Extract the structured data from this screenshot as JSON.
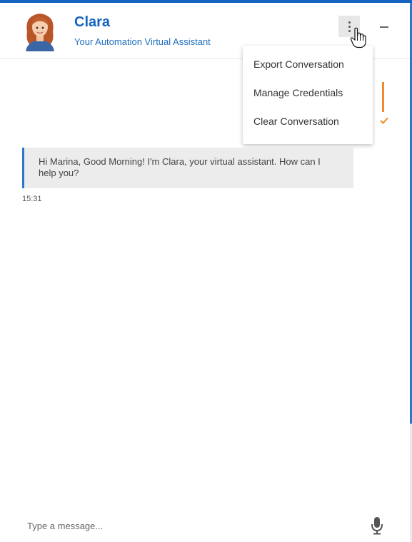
{
  "header": {
    "title": "Clara",
    "subtitle": "Your Automation Virtual Assistant"
  },
  "menu": {
    "items": [
      {
        "label": "Export Conversation"
      },
      {
        "label": "Manage Credentials"
      },
      {
        "label": "Clear Conversation"
      }
    ]
  },
  "partial_user_message": {
    "time_fragment": ")"
  },
  "messages": [
    {
      "sender": "bot",
      "text": "Hi Marina, Good Morning! I'm Clara, your virtual assistant. How can I help you?",
      "time": "15:31"
    }
  ],
  "composer": {
    "placeholder": "Type a message..."
  },
  "colors": {
    "brand_blue": "#1565c0",
    "accent_orange": "#f08a2c",
    "bot_bubble": "#ececec"
  },
  "icons": [
    "avatar",
    "more-vertical-icon",
    "hand-pointer-icon",
    "minimize-icon",
    "check-icon",
    "microphone-icon"
  ]
}
